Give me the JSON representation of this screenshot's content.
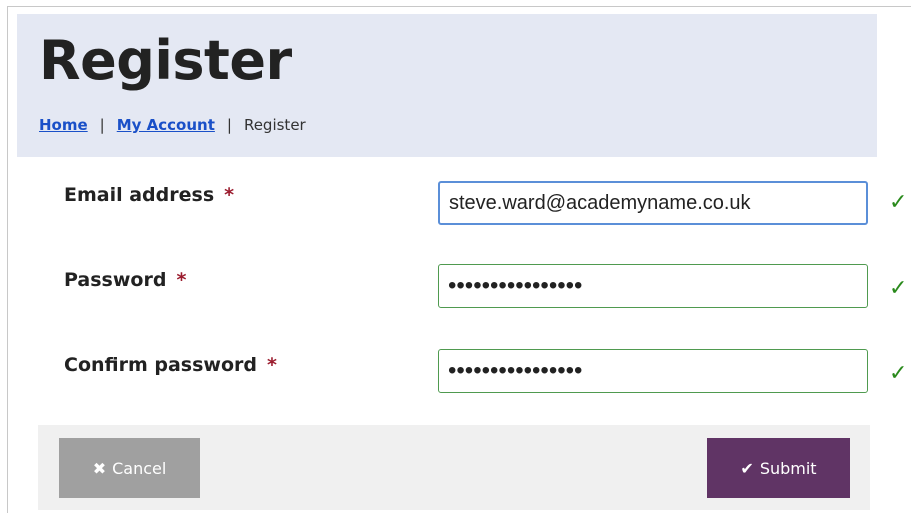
{
  "header": {
    "title": "Register",
    "breadcrumb": {
      "home": "Home",
      "account": "My Account",
      "current": "Register",
      "separator": "|"
    }
  },
  "form": {
    "email": {
      "label": "Email address",
      "required_mark": "*",
      "value": "steve.ward@academyname.co.uk",
      "valid_mark": "✓"
    },
    "password": {
      "label": "Password",
      "required_mark": "*",
      "value": "••••••••••••••••",
      "valid_mark": "✓"
    },
    "confirm": {
      "label": "Confirm password",
      "required_mark": "*",
      "value": "••••••••••••••••",
      "valid_mark": "✓"
    }
  },
  "actions": {
    "cancel_icon": "✖",
    "cancel_label": "Cancel",
    "submit_icon": "✔",
    "submit_label": "Submit"
  },
  "colors": {
    "header_bg": "#e4e8f3",
    "link": "#1a50c8",
    "required": "#9b1c2e",
    "valid": "#2a8a1c",
    "submit_bg": "#603465",
    "cancel_bg": "#a0a0a0"
  },
  "icons": {
    "valid": "check-icon",
    "cancel": "close-icon",
    "submit": "checkmark-icon"
  }
}
